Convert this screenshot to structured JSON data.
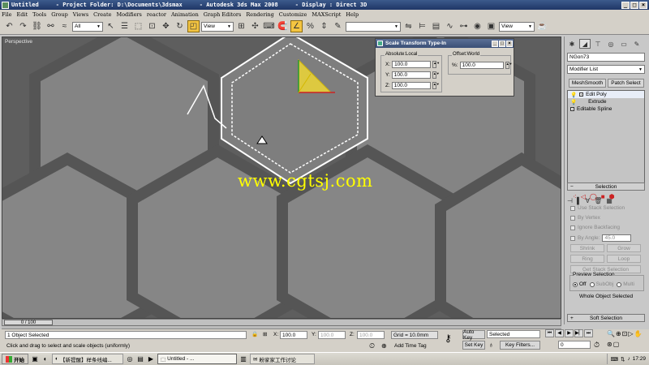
{
  "window": {
    "title": "Untitled     - Project Folder: D:\\Documents\\3dsmax     - Autodesk 3ds Max 2008     - Display : Direct 3D",
    "min": "_",
    "max": "□",
    "close": "×"
  },
  "menu": [
    "File",
    "Edit",
    "Tools",
    "Group",
    "Views",
    "Create",
    "Modifiers",
    "reactor",
    "Animation",
    "Graph Editors",
    "Rendering",
    "Customize",
    "MAXScript",
    "Help"
  ],
  "toolbar": {
    "selection_filter": "All",
    "ref_coord": "View",
    "view_right": "View"
  },
  "viewport": {
    "label": "Perspective",
    "watermark": "www.cgtsj.com"
  },
  "scale_dialog": {
    "title": "Scale Transform Type-In",
    "absolute_label": "Absolute:Local",
    "offset_label": "Offset:World",
    "x_label": "X:",
    "x_value": "100.0",
    "y_label": "Y:",
    "y_value": "100.0",
    "z_label": "Z:",
    "z_value": "100.0",
    "pct_label": "%:",
    "pct_value": "100.0"
  },
  "command_panel": {
    "object_name": "NGon73",
    "modifier_list": "Modifier List",
    "meshsmooth": "MeshSmooth",
    "patch_select": "Patch Select",
    "stack": [
      "Edit Poly",
      "Extrude",
      "Editable Spline"
    ],
    "selection_rollout": "Selection",
    "use_stack_selection": "Use Stack Selection",
    "by_vertex": "By Vertex",
    "ignore_backfacing": "Ignore Backfacing",
    "by_angle": "By Angle:",
    "by_angle_value": "45.0",
    "shrink": "Shrink",
    "grow": "Grow",
    "ring": "Ring",
    "loop": "Loop",
    "get_stack_selection": "Get Stack Selection",
    "preview_selection": "Preview Selection",
    "preview_off": "Off",
    "preview_subobj": "SubObj",
    "preview_multi": "Multi",
    "whole_object_selected": "Whole Object Selected",
    "soft_selection": "Soft Selection"
  },
  "timeline": {
    "position": "0 / 100"
  },
  "status": {
    "objects_selected": "1 Object Selected",
    "prompt": "Click and drag to select and scale objects (uniformly)",
    "x_label": "X:",
    "x_value": "100.0",
    "y_label": "Y:",
    "y_value": "100.0",
    "z_label": "Z:",
    "z_value": "100.0",
    "grid": "Grid = 10.0mm",
    "add_time_tag": "Add Time Tag",
    "auto_key": "Auto Key",
    "set_key": "Set Key",
    "selected": "Selected",
    "key_filters": "Key Filters...",
    "frame": "0"
  },
  "taskbar": {
    "start": "开始",
    "items": [
      "【新提醒】样条线编...",
      "Untitled      - ...",
      "粉家家工作讨论"
    ],
    "time": "17:29"
  },
  "colors": {
    "accent": "#f4c542",
    "viewport_bg": "#7a7a7a",
    "watermark": "#ffff00"
  }
}
